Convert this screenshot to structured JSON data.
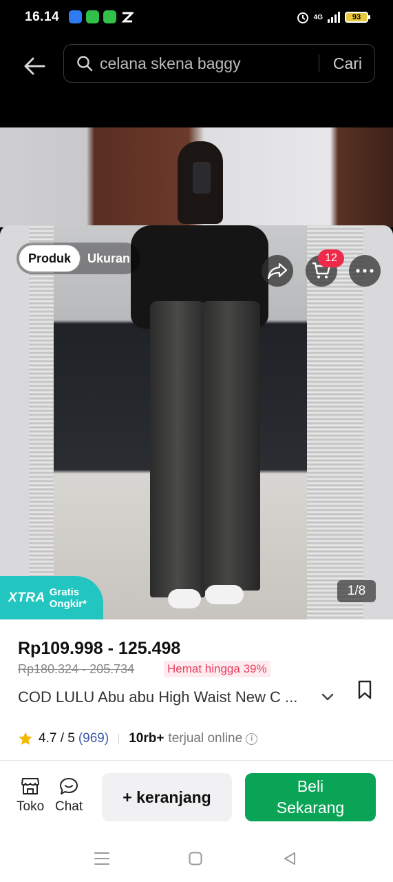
{
  "status_bar": {
    "time": "16.14",
    "network": "4G",
    "battery": "93"
  },
  "search": {
    "query": "celana skena baggy",
    "button_label": "Cari"
  },
  "gallery": {
    "tabs": [
      "Produk",
      "Ukuran"
    ],
    "cart_count": "12",
    "page_counter": "1/8",
    "promo": {
      "brand": "XTRA",
      "line1": "Gratis",
      "line2": "Ongkir*"
    }
  },
  "product": {
    "price_range": "Rp109.998 - 125.498",
    "original_price": "Rp180.324 - 205.734",
    "discount_label": "Hemat hingga 39%",
    "title": "COD LULU Abu abu High Waist New C ...",
    "rating": "4.7 / 5",
    "review_count": "(969)",
    "sold_count": "10rb+",
    "sold_label": "terjual online"
  },
  "actions": {
    "shop_label": "Toko",
    "chat_label": "Chat",
    "add_to_cart_label": "+ keranjang",
    "buy_now_line1": "Beli",
    "buy_now_line2": "Sekarang"
  },
  "colors": {
    "accent_green": "#0aa456",
    "badge_red": "#ee2a4a",
    "promo_teal": "#22c5bf",
    "discount_pink": "#ea3e5e",
    "star_yellow": "#f5b800"
  }
}
